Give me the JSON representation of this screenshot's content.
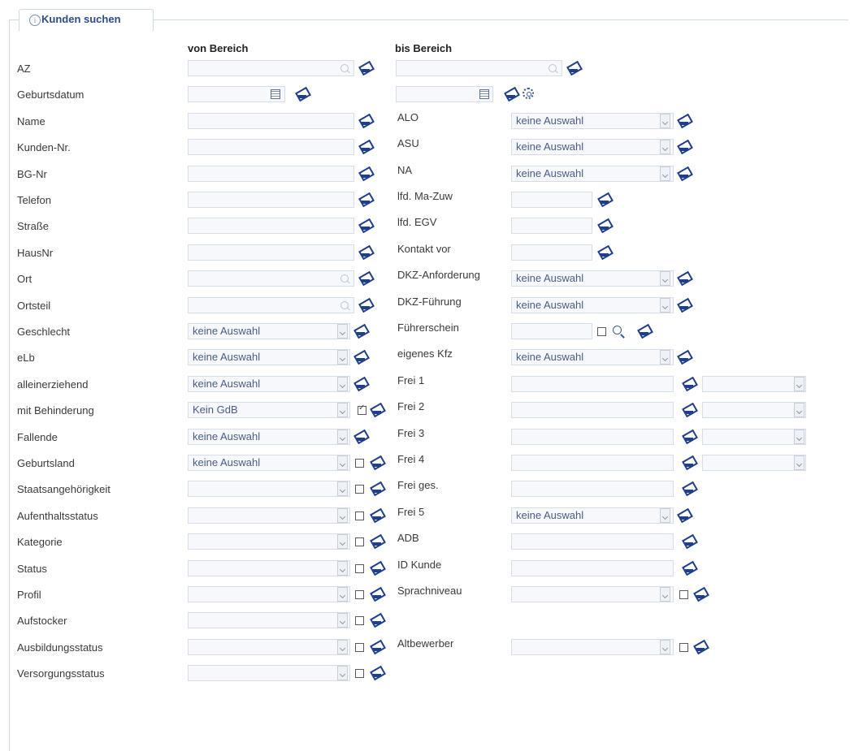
{
  "fieldset": {
    "legend": "Kunden suchen",
    "legend_icon": "info-icon"
  },
  "headers": {
    "von": "von Bereich",
    "bis": "bis Bereich"
  },
  "left_rows": [
    {
      "label": "AZ",
      "value": ""
    },
    {
      "label": "Geburtsdatum",
      "value": ""
    },
    {
      "label": "Name",
      "value": ""
    },
    {
      "label": "Kunden-Nr.",
      "value": ""
    },
    {
      "label": "BG-Nr",
      "value": ""
    },
    {
      "label": "Telefon",
      "value": ""
    },
    {
      "label": "Straße",
      "value": ""
    },
    {
      "label": "HausNr",
      "value": ""
    },
    {
      "label": "Ort",
      "value": ""
    },
    {
      "label": "Ortsteil",
      "value": ""
    },
    {
      "label": "Geschlecht",
      "value": "keine Auswahl"
    },
    {
      "label": "eLb",
      "value": "keine Auswahl"
    },
    {
      "label": "alleinerziehend",
      "value": "keine Auswahl"
    },
    {
      "label": "mit Behinderung",
      "value": "Kein GdB"
    },
    {
      "label": "Fallende",
      "value": "keine Auswahl"
    },
    {
      "label": "Geburtsland",
      "value": "keine Auswahl"
    },
    {
      "label": "Staatsangehörigkeit",
      "value": ""
    },
    {
      "label": "Aufenthaltsstatus",
      "value": ""
    },
    {
      "label": "Kategorie",
      "value": ""
    },
    {
      "label": "Status",
      "value": ""
    },
    {
      "label": "Profil",
      "value": ""
    },
    {
      "label": "Aufstocker",
      "value": ""
    },
    {
      "label": "Ausbildungsstatus",
      "value": ""
    },
    {
      "label": "Versorgungsstatus",
      "value": ""
    }
  ],
  "right_rows": [
    {
      "label": "ALO",
      "value": "keine Auswahl"
    },
    {
      "label": "ASU",
      "value": "keine Auswahl"
    },
    {
      "label": "NA",
      "value": "keine Auswahl"
    },
    {
      "label": "lfd. Ma-Zuw",
      "value": ""
    },
    {
      "label": "lfd. EGV",
      "value": ""
    },
    {
      "label": "Kontakt vor",
      "value": ""
    },
    {
      "label": "DKZ-Anforderung",
      "value": "keine Auswahl"
    },
    {
      "label": "DKZ-Führung",
      "value": "keine Auswahl"
    },
    {
      "label": "Führerschein",
      "value": ""
    },
    {
      "label": "eigenes Kfz",
      "value": "keine Auswahl"
    },
    {
      "label": "Frei 1",
      "value": ""
    },
    {
      "label": "Frei 2",
      "value": ""
    },
    {
      "label": "Frei 3",
      "value": ""
    },
    {
      "label": "Frei 4",
      "value": ""
    },
    {
      "label": "Frei ges.",
      "value": ""
    },
    {
      "label": "Frei 5",
      "value": "keine Auswahl"
    },
    {
      "label": "ADB",
      "value": ""
    },
    {
      "label": "ID Kunde",
      "value": ""
    },
    {
      "label": "Sprachniveau",
      "value": ""
    },
    {
      "label": "Altbewerber",
      "value": ""
    }
  ],
  "icons": {
    "clear": "eraser-icon",
    "search": "magnifier-icon",
    "calendar": "calendar-icon",
    "settings": "gear-icon",
    "dropdown": "chevron-down-icon"
  },
  "colors": {
    "legend_text": "#2c4b87",
    "select_text": "#4a5d85",
    "icon": "#1f3f8c",
    "border": "#d6dde8"
  }
}
